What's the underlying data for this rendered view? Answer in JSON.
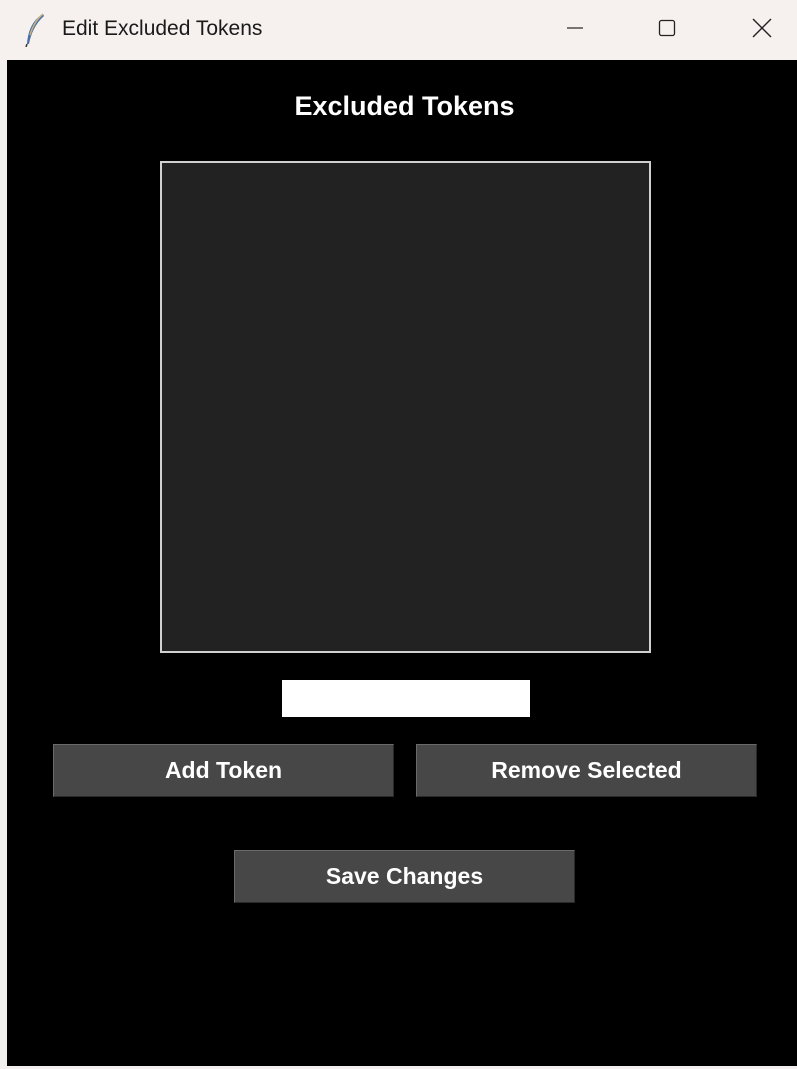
{
  "window": {
    "title": "Edit Excluded Tokens",
    "app_icon": "feather-icon",
    "controls": {
      "minimize_icon": "minimize-icon",
      "maximize_icon": "maximize-icon",
      "close_icon": "close-icon"
    }
  },
  "main": {
    "heading": "Excluded Tokens",
    "token_list": {
      "items": []
    },
    "token_input": {
      "value": "",
      "placeholder": ""
    },
    "buttons": {
      "add_label": "Add Token",
      "remove_label": "Remove Selected",
      "save_label": "Save Changes"
    }
  },
  "colors": {
    "client_background": "#000000",
    "listbox_background": "#222222",
    "button_background": "#474747",
    "text": "#ffffff"
  }
}
